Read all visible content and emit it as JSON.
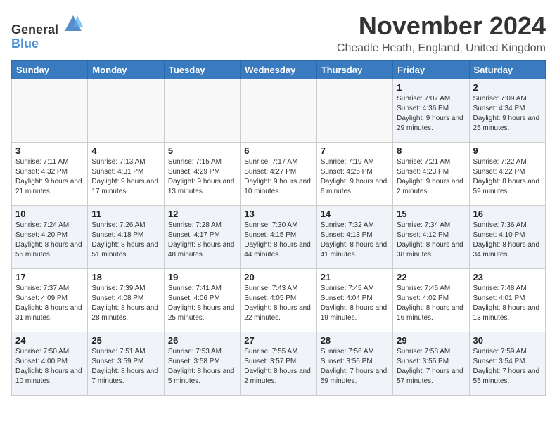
{
  "header": {
    "logo_general": "General",
    "logo_blue": "Blue",
    "month_title": "November 2024",
    "location": "Cheadle Heath, England, United Kingdom"
  },
  "weekdays": [
    "Sunday",
    "Monday",
    "Tuesday",
    "Wednesday",
    "Thursday",
    "Friday",
    "Saturday"
  ],
  "weeks": [
    [
      {
        "day": "",
        "info": ""
      },
      {
        "day": "",
        "info": ""
      },
      {
        "day": "",
        "info": ""
      },
      {
        "day": "",
        "info": ""
      },
      {
        "day": "",
        "info": ""
      },
      {
        "day": "1",
        "info": "Sunrise: 7:07 AM\nSunset: 4:36 PM\nDaylight: 9 hours and 29 minutes."
      },
      {
        "day": "2",
        "info": "Sunrise: 7:09 AM\nSunset: 4:34 PM\nDaylight: 9 hours and 25 minutes."
      }
    ],
    [
      {
        "day": "3",
        "info": "Sunrise: 7:11 AM\nSunset: 4:32 PM\nDaylight: 9 hours and 21 minutes."
      },
      {
        "day": "4",
        "info": "Sunrise: 7:13 AM\nSunset: 4:31 PM\nDaylight: 9 hours and 17 minutes."
      },
      {
        "day": "5",
        "info": "Sunrise: 7:15 AM\nSunset: 4:29 PM\nDaylight: 9 hours and 13 minutes."
      },
      {
        "day": "6",
        "info": "Sunrise: 7:17 AM\nSunset: 4:27 PM\nDaylight: 9 hours and 10 minutes."
      },
      {
        "day": "7",
        "info": "Sunrise: 7:19 AM\nSunset: 4:25 PM\nDaylight: 9 hours and 6 minutes."
      },
      {
        "day": "8",
        "info": "Sunrise: 7:21 AM\nSunset: 4:23 PM\nDaylight: 9 hours and 2 minutes."
      },
      {
        "day": "9",
        "info": "Sunrise: 7:22 AM\nSunset: 4:22 PM\nDaylight: 8 hours and 59 minutes."
      }
    ],
    [
      {
        "day": "10",
        "info": "Sunrise: 7:24 AM\nSunset: 4:20 PM\nDaylight: 8 hours and 55 minutes."
      },
      {
        "day": "11",
        "info": "Sunrise: 7:26 AM\nSunset: 4:18 PM\nDaylight: 8 hours and 51 minutes."
      },
      {
        "day": "12",
        "info": "Sunrise: 7:28 AM\nSunset: 4:17 PM\nDaylight: 8 hours and 48 minutes."
      },
      {
        "day": "13",
        "info": "Sunrise: 7:30 AM\nSunset: 4:15 PM\nDaylight: 8 hours and 44 minutes."
      },
      {
        "day": "14",
        "info": "Sunrise: 7:32 AM\nSunset: 4:13 PM\nDaylight: 8 hours and 41 minutes."
      },
      {
        "day": "15",
        "info": "Sunrise: 7:34 AM\nSunset: 4:12 PM\nDaylight: 8 hours and 38 minutes."
      },
      {
        "day": "16",
        "info": "Sunrise: 7:36 AM\nSunset: 4:10 PM\nDaylight: 8 hours and 34 minutes."
      }
    ],
    [
      {
        "day": "17",
        "info": "Sunrise: 7:37 AM\nSunset: 4:09 PM\nDaylight: 8 hours and 31 minutes."
      },
      {
        "day": "18",
        "info": "Sunrise: 7:39 AM\nSunset: 4:08 PM\nDaylight: 8 hours and 28 minutes."
      },
      {
        "day": "19",
        "info": "Sunrise: 7:41 AM\nSunset: 4:06 PM\nDaylight: 8 hours and 25 minutes."
      },
      {
        "day": "20",
        "info": "Sunrise: 7:43 AM\nSunset: 4:05 PM\nDaylight: 8 hours and 22 minutes."
      },
      {
        "day": "21",
        "info": "Sunrise: 7:45 AM\nSunset: 4:04 PM\nDaylight: 8 hours and 19 minutes."
      },
      {
        "day": "22",
        "info": "Sunrise: 7:46 AM\nSunset: 4:02 PM\nDaylight: 8 hours and 16 minutes."
      },
      {
        "day": "23",
        "info": "Sunrise: 7:48 AM\nSunset: 4:01 PM\nDaylight: 8 hours and 13 minutes."
      }
    ],
    [
      {
        "day": "24",
        "info": "Sunrise: 7:50 AM\nSunset: 4:00 PM\nDaylight: 8 hours and 10 minutes."
      },
      {
        "day": "25",
        "info": "Sunrise: 7:51 AM\nSunset: 3:59 PM\nDaylight: 8 hours and 7 minutes."
      },
      {
        "day": "26",
        "info": "Sunrise: 7:53 AM\nSunset: 3:58 PM\nDaylight: 8 hours and 5 minutes."
      },
      {
        "day": "27",
        "info": "Sunrise: 7:55 AM\nSunset: 3:57 PM\nDaylight: 8 hours and 2 minutes."
      },
      {
        "day": "28",
        "info": "Sunrise: 7:56 AM\nSunset: 3:56 PM\nDaylight: 7 hours and 59 minutes."
      },
      {
        "day": "29",
        "info": "Sunrise: 7:58 AM\nSunset: 3:55 PM\nDaylight: 7 hours and 57 minutes."
      },
      {
        "day": "30",
        "info": "Sunrise: 7:59 AM\nSunset: 3:54 PM\nDaylight: 7 hours and 55 minutes."
      }
    ]
  ]
}
